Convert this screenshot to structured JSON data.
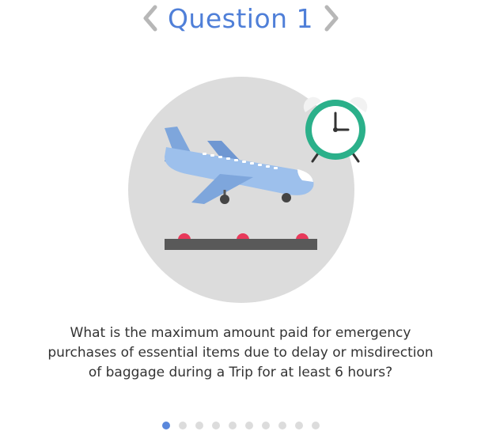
{
  "header": {
    "title": "Question 1",
    "prev_icon": "chevron-left-icon",
    "next_icon": "chevron-right-icon"
  },
  "illustration": {
    "icons": [
      "airplane-icon",
      "alarm-clock-icon",
      "runway-icon"
    ],
    "clock_ring_color": "#2bb08a",
    "plane_color": "#8fb5e6",
    "circle_color": "#dcdcdc"
  },
  "question": {
    "lines": [
      "What is the maximum amount paid for emergency",
      "purchases of essential items  due to delay or misdirection",
      "of baggage during a Trip for at least 6 hours?"
    ]
  },
  "pagination": {
    "total": 10,
    "current": 1,
    "active_color": "#5a88dc",
    "inactive_color": "#dcdcdc"
  }
}
